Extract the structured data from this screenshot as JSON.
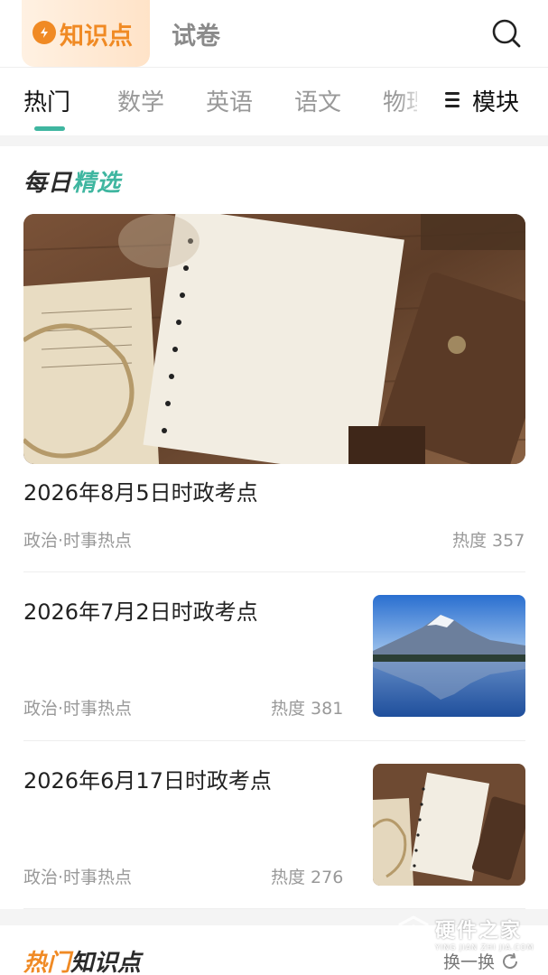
{
  "header": {
    "tabs": [
      {
        "label": "知识点",
        "active": true
      },
      {
        "label": "试卷",
        "active": false
      }
    ],
    "search_icon": "search-icon",
    "accent_color": "#f08a24"
  },
  "subjects": {
    "items": [
      "热门",
      "数学",
      "英语",
      "语文",
      "物理"
    ],
    "active_index": 0,
    "module_label": "模块",
    "underline_color": "#3fb6a0"
  },
  "daily": {
    "title_part1": "每日",
    "title_part2": "精选",
    "articles": [
      {
        "title": "2026年8月5日时政考点",
        "tags": "政治·时事热点",
        "heat": "热度 357",
        "image": "notebook-desk-photo"
      },
      {
        "title": "2026年7月2日时政考点",
        "tags": "政治·时事热点",
        "heat": "热度 381",
        "image": "mountain-lake-photo"
      },
      {
        "title": "2026年6月17日时政考点",
        "tags": "政治·时事热点",
        "heat": "热度 276",
        "image": "notebook-desk-photo"
      }
    ]
  },
  "hot": {
    "title_part1": "热门",
    "title_part2": "知识点",
    "refresh_label": "换一换"
  },
  "watermark": {
    "name": "硬件之家",
    "pinyin": "YING JIAN ZHI JIA.COM"
  }
}
